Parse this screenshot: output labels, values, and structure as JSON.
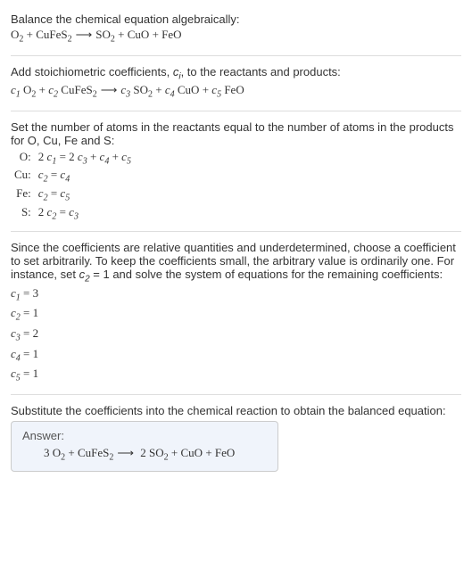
{
  "intro": {
    "line1": "Balance the chemical equation algebraically:"
  },
  "eq1": {
    "O2": "O",
    "O2_sub": "2",
    "plus1": " + ",
    "CuFeS2": "CuFeS",
    "CuFeS2_sub": "2",
    "arrow": "⟶",
    "SO2": "SO",
    "SO2_sub": "2",
    "plus2": " + ",
    "CuO": "CuO",
    "plus3": " + ",
    "FeO": "FeO"
  },
  "stoich": {
    "text_a": "Add stoichiometric coefficients, ",
    "ci_c": "c",
    "ci_i": "i",
    "text_b": ", to the reactants and products:"
  },
  "eq2": {
    "c1": "c",
    "c1_sub": "1",
    "sp1": " ",
    "O2": "O",
    "O2_sub": "2",
    "plus1": " + ",
    "c2": "c",
    "c2_sub": "2",
    "sp2": " ",
    "CuFeS2": "CuFeS",
    "CuFeS2_sub": "2",
    "arrow": "⟶",
    "c3": "c",
    "c3_sub": "3",
    "sp3": " ",
    "SO2": "SO",
    "SO2_sub": "2",
    "plus2": " + ",
    "c4": "c",
    "c4_sub": "4",
    "sp4": " ",
    "CuO": "CuO",
    "plus3": " + ",
    "c5": "c",
    "c5_sub": "5",
    "sp5": " ",
    "FeO": "FeO"
  },
  "atoms": {
    "intro": "Set the number of atoms in the reactants equal to the number of atoms in the products for O, Cu, Fe and S:",
    "rows": {
      "O": {
        "elem": "O:",
        "lhs_a": "2 ",
        "lhs_c": "c",
        "lhs_sub": "1",
        "eq": " = 2 ",
        "r1c": "c",
        "r1s": "3",
        "p1": " + ",
        "r2c": "c",
        "r2s": "4",
        "p2": " + ",
        "r3c": "c",
        "r3s": "5"
      },
      "Cu": {
        "elem": "Cu:",
        "lhs_c": "c",
        "lhs_sub": "2",
        "eq": " = ",
        "r1c": "c",
        "r1s": "4"
      },
      "Fe": {
        "elem": "Fe:",
        "lhs_c": "c",
        "lhs_sub": "2",
        "eq": " = ",
        "r1c": "c",
        "r1s": "5"
      },
      "S": {
        "elem": "S:",
        "lhs_a": "2 ",
        "lhs_c": "c",
        "lhs_sub": "2",
        "eq": " = ",
        "r1c": "c",
        "r1s": "3"
      }
    }
  },
  "choose": {
    "text_a": "Since the coefficients are relative quantities and underdetermined, choose a coefficient to set arbitrarily. To keep the coefficients small, the arbitrary value is ordinarily one. For instance, set ",
    "c2_c": "c",
    "c2_sub": "2",
    "text_b": " = 1 and solve the system of equations for the remaining coefficients:"
  },
  "sol": {
    "c1": {
      "c": "c",
      "sub": "1",
      "eq": " = 3"
    },
    "c2": {
      "c": "c",
      "sub": "2",
      "eq": " = 1"
    },
    "c3": {
      "c": "c",
      "sub": "3",
      "eq": " = 2"
    },
    "c4": {
      "c": "c",
      "sub": "4",
      "eq": " = 1"
    },
    "c5": {
      "c": "c",
      "sub": "5",
      "eq": " = 1"
    }
  },
  "final": {
    "text": "Substitute the coefficients into the chemical reaction to obtain the balanced equation:"
  },
  "answer": {
    "title": "Answer:",
    "three": "3 ",
    "O2": "O",
    "O2_sub": "2",
    "plus1": " + ",
    "CuFeS2": "CuFeS",
    "CuFeS2_sub": "2",
    "arrow": "⟶",
    "two": " 2 ",
    "SO2": "SO",
    "SO2_sub": "2",
    "plus2": " + ",
    "CuO": "CuO",
    "plus3": " + ",
    "FeO": "FeO"
  }
}
